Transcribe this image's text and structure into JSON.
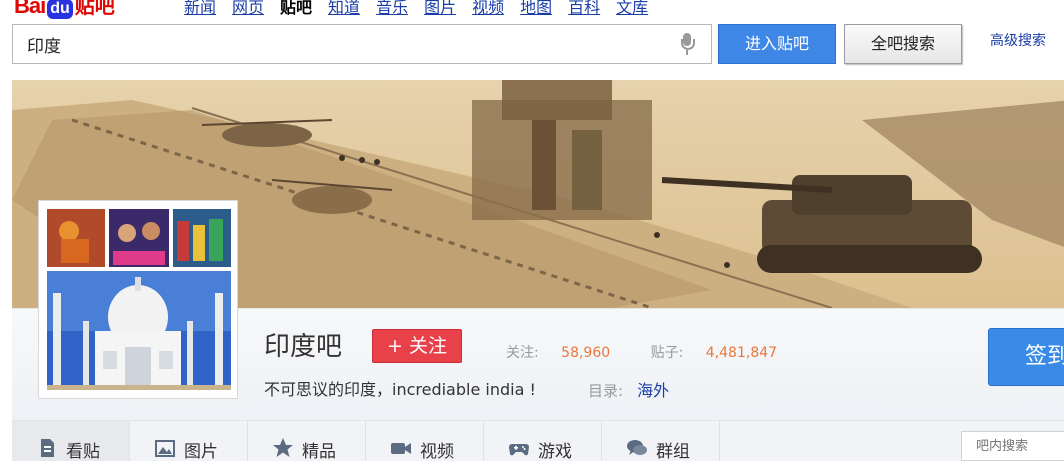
{
  "logo": {
    "bai": "Bai",
    "paw": "du",
    "tieba": "贴吧"
  },
  "nav": [
    "新闻",
    "网页",
    "贴吧",
    "知道",
    "音乐",
    "图片",
    "视频",
    "地图",
    "百科",
    "文库"
  ],
  "search": {
    "value": "印度",
    "enter_label": "进入贴吧",
    "all_label": "全吧搜索",
    "advanced": "高级搜索"
  },
  "forum": {
    "name": "印度吧",
    "follow_label": "+ 关注",
    "stats": {
      "follow_label": "关注:",
      "follow_value": "58,960",
      "posts_label": "贴子:",
      "posts_value": "4,481,847"
    },
    "slogan": "不可思议的印度，incrediable india !",
    "dir_label": "目录:",
    "dir_value": "海外",
    "signin_label": "签到"
  },
  "tabs": [
    {
      "label": "看贴",
      "icon": "document-icon"
    },
    {
      "label": "图片",
      "icon": "picture-icon"
    },
    {
      "label": "精品",
      "icon": "star-icon"
    },
    {
      "label": "视频",
      "icon": "video-icon"
    },
    {
      "label": "游戏",
      "icon": "gamepad-icon"
    },
    {
      "label": "群组",
      "icon": "chat-icon"
    }
  ],
  "inner_search": {
    "placeholder": "吧内搜索"
  }
}
